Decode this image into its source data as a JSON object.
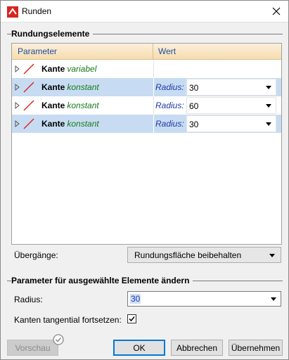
{
  "window": {
    "title": "Runden"
  },
  "group_elements": {
    "title": "Rundungselemente"
  },
  "tree": {
    "columns": [
      "Parameter",
      "Wert"
    ],
    "rows": [
      {
        "label": "Kante",
        "type": "variabel",
        "param": "",
        "value": "",
        "selected": false
      },
      {
        "label": "Kante",
        "type": "konstant",
        "param": "Radius:",
        "value": "30",
        "selected": true
      },
      {
        "label": "Kante",
        "type": "konstant",
        "param": "Radius:",
        "value": "60",
        "selected": false
      },
      {
        "label": "Kante",
        "type": "konstant",
        "param": "Radius:",
        "value": "30",
        "selected": true
      }
    ]
  },
  "transitions": {
    "label": "Übergänge:",
    "value": "Rundungsfläche beibehalten"
  },
  "group_params": {
    "title": "Parameter für ausgewählte Elemente ändern"
  },
  "radius": {
    "label": "Radius:",
    "value": "30"
  },
  "tangential": {
    "label": "Kanten tangential fortsetzen:",
    "checked": true
  },
  "buttons": {
    "preview": "Vorschau",
    "ok": "OK",
    "cancel": "Abbrechen",
    "apply": "Übernehmen"
  },
  "colors": {
    "accent": "#0078d7",
    "header_gradient_end": "#f6dcae",
    "selected_row": "#c7dcf2",
    "type_text": "#1a7a1a"
  }
}
